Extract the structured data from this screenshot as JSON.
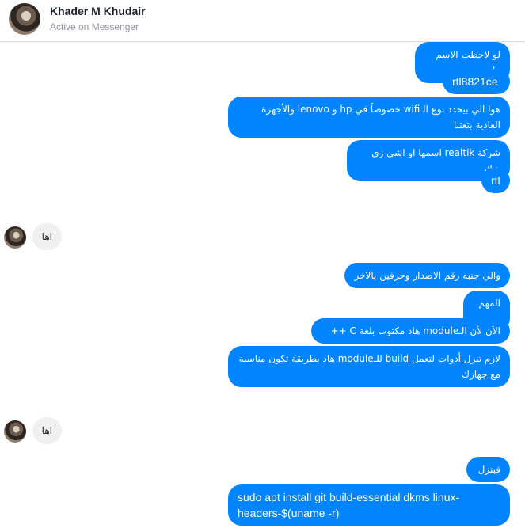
{
  "header": {
    "name": "Khader M Khudair",
    "status": "Active on Messenger"
  },
  "messages": [
    "لو لاحظت الاسم هاد",
    "rtl8821ce",
    "هوا الي بيحدد نوع الـwifi خصوصاً في hp و lenovo والأجهزة العادية بتعتنا",
    "شركة realtik اسمها او اشي زي هيك",
    "rtl",
    "اها",
    "والي جنبه رقم الاصدار وحرفين بالاخر",
    "المهم ..",
    "الأن لأن الـmodule هاد مكتوب بلغة C ++",
    "لازم تنزل أدوات لتعمل build للـmodule هاد بطريقة تكون مناسبة مع جهازك",
    "اها",
    "فبنزل",
    "sudo apt install git build-essential dkms linux-headers-$(uname -r)"
  ],
  "colors": {
    "outgoing_bubble": "#0084ff",
    "incoming_bubble": "#f1f0f0"
  }
}
